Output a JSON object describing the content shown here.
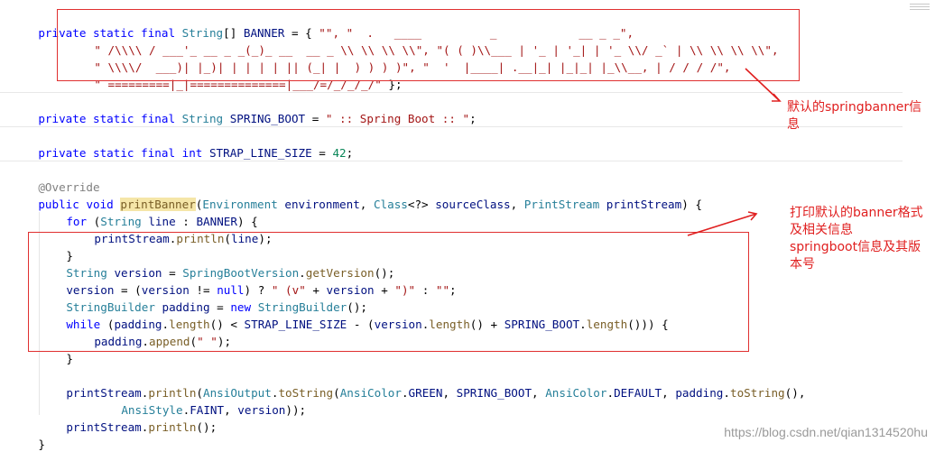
{
  "code": {
    "l1": [
      "private",
      " ",
      "static",
      " ",
      "final",
      " ",
      "String",
      "[] ",
      "BANNER",
      " = { ",
      "\"\", \"  .   ____          _            __ _ _\","
    ],
    "l2": [
      "\" /\\\\\\\\ / ___'_ __ _ _(_)_ __  __ _ \\\\ \\\\ \\\\ \\\\\", \"( ( )\\\\___ | '_ | '_| | '_ \\\\/ _` | \\\\ \\\\ \\\\ \\\\\","
    ],
    "l3": [
      "\" \\\\\\\\/  ___)| |_)| | | | | || (_| |  ) ) ) )\", \"  '  |____| .__|_| |_|_| |_\\\\__, | / / / /\","
    ],
    "l4": [
      "\" =========|_|==============|___/=/_/_/_/\"",
      " };"
    ],
    "l5": [
      "private",
      " ",
      "static",
      " ",
      "final",
      " ",
      "String",
      " ",
      "SPRING_BOOT",
      " = ",
      "\" :: Spring Boot :: \"",
      ";"
    ],
    "l6": [
      "private",
      " ",
      "static",
      " ",
      "final",
      " ",
      "int",
      " ",
      "STRAP_LINE_SIZE",
      " = ",
      "42",
      ";"
    ],
    "l7": [
      "@Override"
    ],
    "l8": [
      "public",
      " ",
      "void",
      " ",
      "printBanner",
      "(",
      "Environment",
      " ",
      "environment",
      ", ",
      "Class",
      "<?> ",
      "sourceClass",
      ", ",
      "PrintStream",
      " ",
      "printStream",
      ") {"
    ],
    "l9": [
      "for",
      " (",
      "String",
      " ",
      "line",
      " : ",
      "BANNER",
      ") {"
    ],
    "l10": [
      "printStream",
      ".",
      "println",
      "(",
      "line",
      ");"
    ],
    "l11": [
      "}"
    ],
    "l12": [
      "String",
      " ",
      "version",
      " = ",
      "SpringBootVersion",
      ".",
      "getVersion",
      "();"
    ],
    "l13": [
      "version",
      " = (",
      "version",
      " != ",
      "null",
      ") ? ",
      "\" (v\"",
      " + ",
      "version",
      " + ",
      "\")\"",
      " : ",
      "\"\"",
      ";"
    ],
    "l14": [
      "StringBuilder",
      " ",
      "padding",
      " = ",
      "new",
      " ",
      "StringBuilder",
      "();"
    ],
    "l15": [
      "while",
      " (",
      "padding",
      ".",
      "length",
      "() < ",
      "STRAP_LINE_SIZE",
      " - (",
      "version",
      ".",
      "length",
      "() + ",
      "SPRING_BOOT",
      ".",
      "length",
      "())) {"
    ],
    "l16": [
      "padding",
      ".",
      "append",
      "(",
      "\" \"",
      ");"
    ],
    "l17": [
      "}"
    ],
    "l18": [
      "printStream",
      ".",
      "println",
      "(",
      "AnsiOutput",
      ".",
      "toString",
      "(",
      "AnsiColor",
      ".",
      "GREEN",
      ", ",
      "SPRING_BOOT",
      ", ",
      "AnsiColor",
      ".",
      "DEFAULT",
      ", ",
      "padding",
      ".",
      "toString",
      "(),"
    ],
    "l19": [
      "AnsiStyle",
      ".",
      "FAINT",
      ", ",
      "version",
      "));"
    ],
    "l20": [
      "printStream",
      ".",
      "println",
      "();"
    ],
    "l21": [
      "}"
    ]
  },
  "annotations": {
    "note1": "默认的springbanner信\n息",
    "note2": "打印默认的banner格式\n及相关信息\nspringboot信息及其版\n本号"
  },
  "watermark": "https://blog.csdn.net/qian1314520hu",
  "colors": {
    "keyword": "#0000ff",
    "type": "#267f99",
    "identifier": "#001080",
    "method": "#795e26",
    "string": "#a31515",
    "number": "#098658",
    "annotation_box": "#e03030",
    "note_text": "#e02020"
  }
}
